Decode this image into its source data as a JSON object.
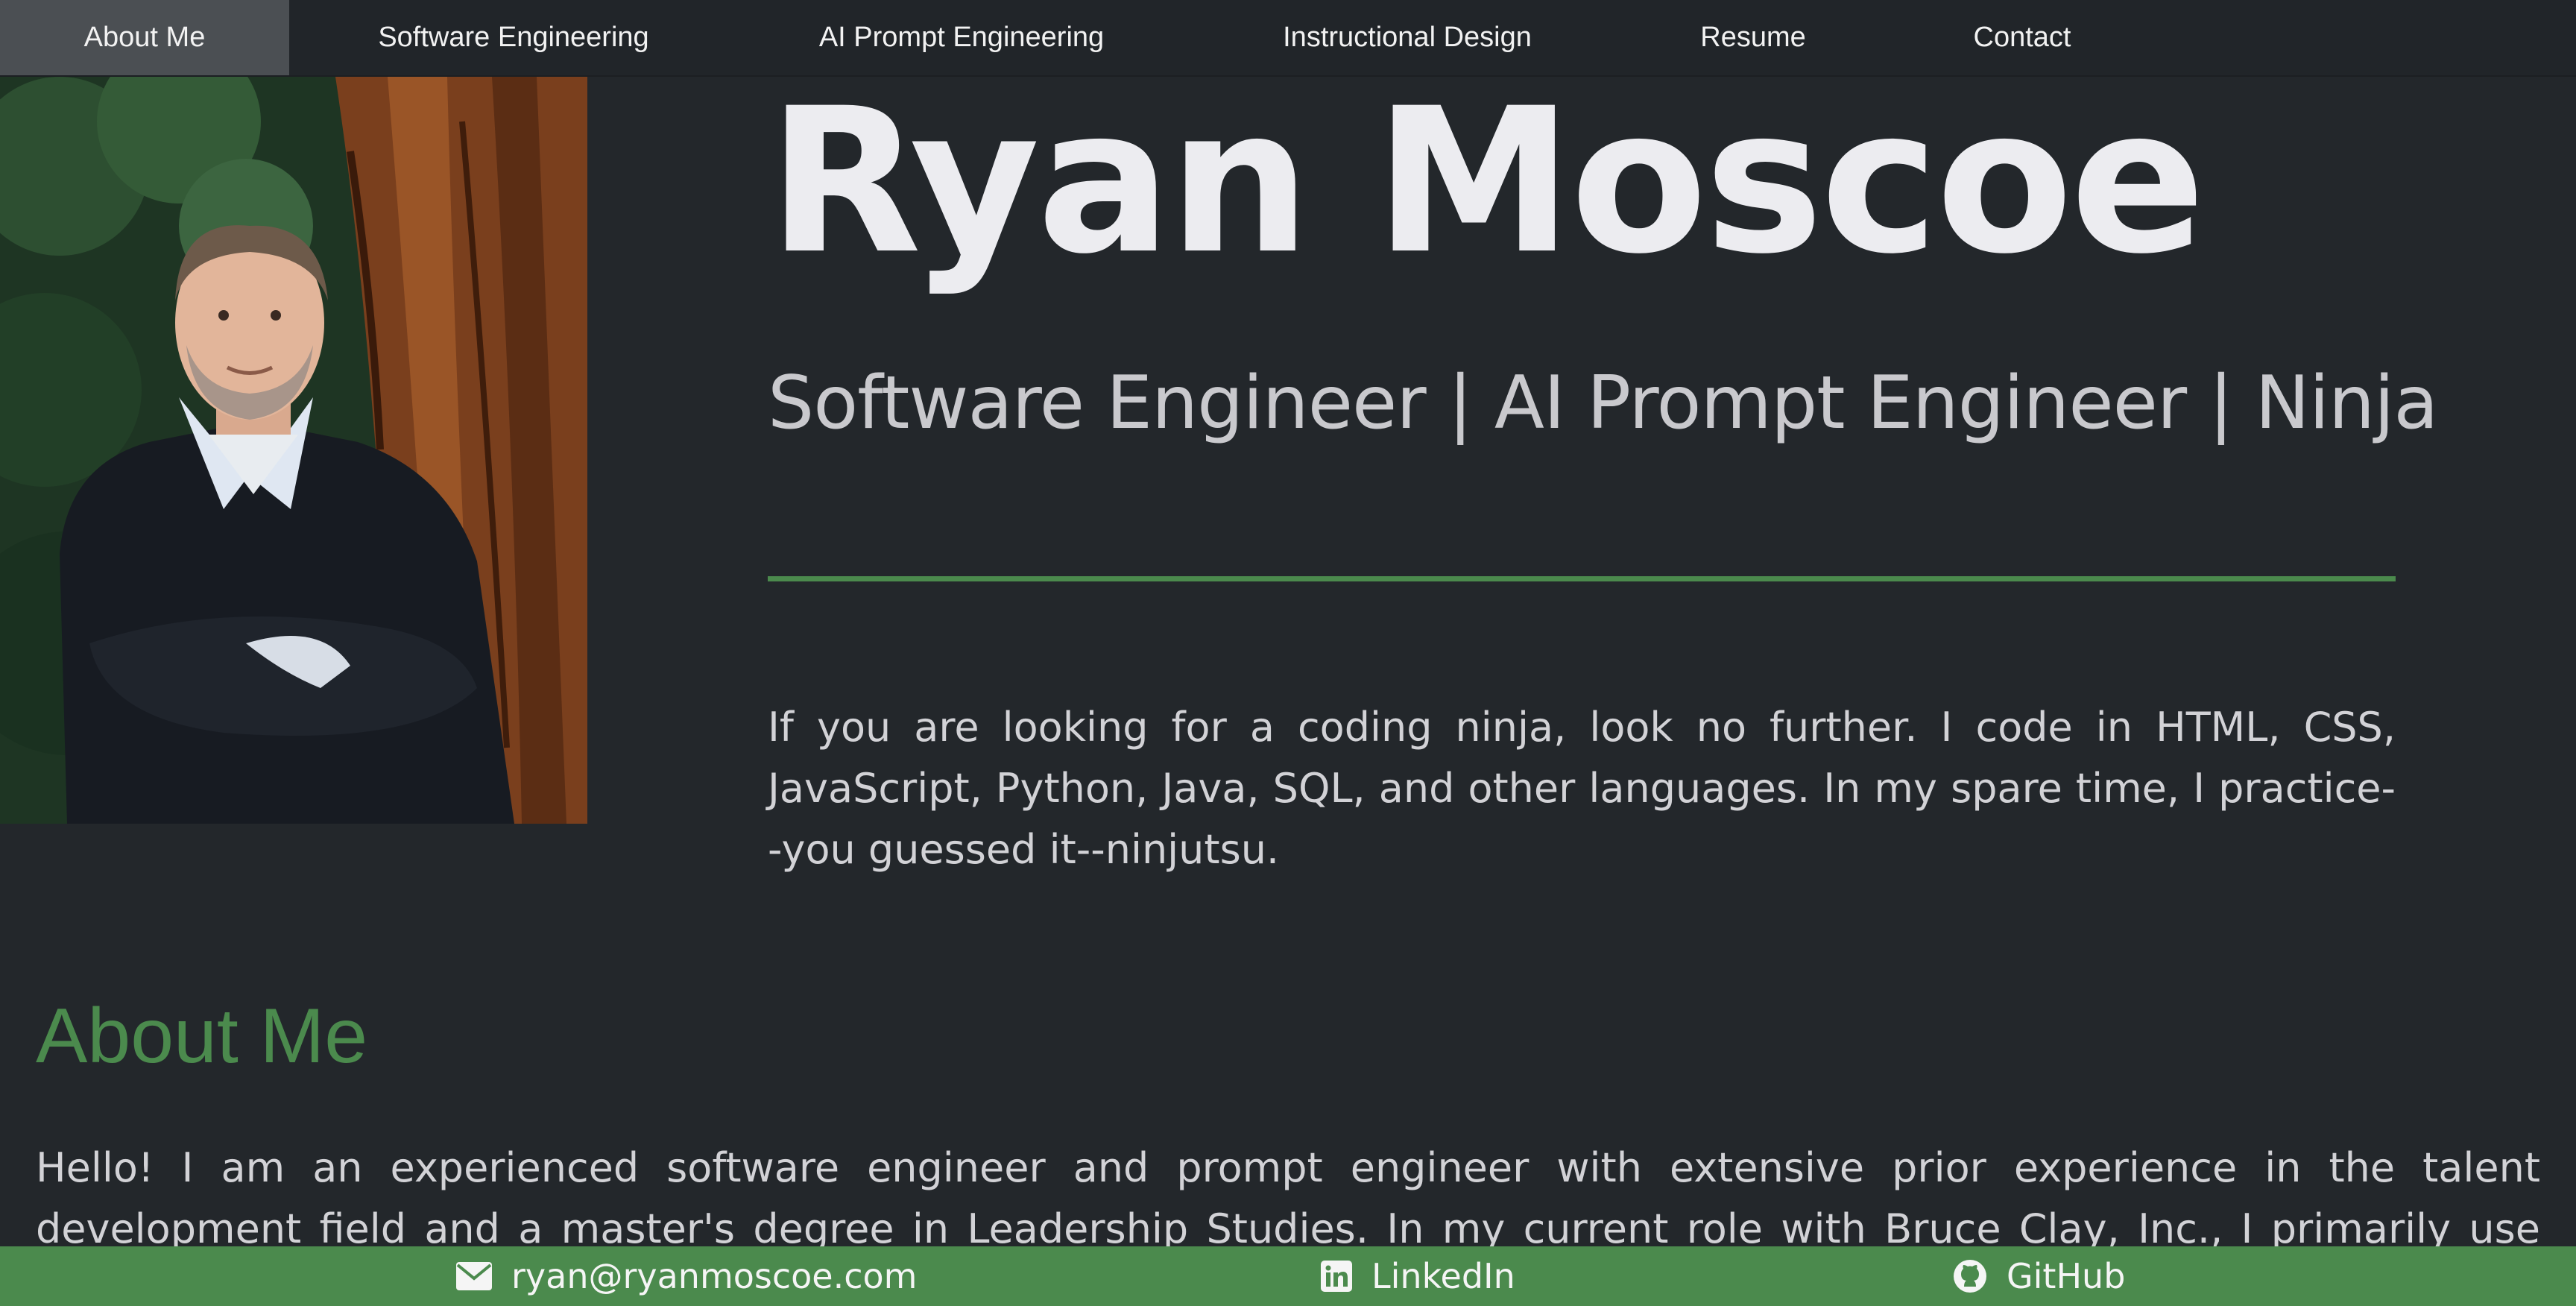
{
  "nav": {
    "items": [
      {
        "label": "About Me",
        "active": true
      },
      {
        "label": "Software Engineering",
        "active": false
      },
      {
        "label": "AI Prompt Engineering",
        "active": false
      },
      {
        "label": "Instructional Design",
        "active": false
      },
      {
        "label": "Resume",
        "active": false
      },
      {
        "label": "Contact",
        "active": false
      }
    ]
  },
  "hero": {
    "name": "Ryan Moscoe",
    "subtitle": "Software Engineer | AI Prompt Engineer | Ninja",
    "blurb": "If you are looking for a coding ninja, look no further. I code in HTML, CSS, JavaScript, Python, Java, SQL, and other languages. In my spare time, I practice--you guessed it--ninjutsu."
  },
  "about": {
    "title": "About Me",
    "text": "Hello! I am an experienced software engineer and prompt engineer with extensive prior experience in the talent development field and a master's degree in Leadership Studies. In my current role with Bruce Clay, Inc., I primarily use Python, JavaScript, and SQL, along with a variety"
  },
  "footer": {
    "email": "ryan@ryanmoscoe.com",
    "linkedin": "LinkedIn",
    "github": "GitHub"
  },
  "colors": {
    "background": "#23272b",
    "navbar": "#212529",
    "accent_green": "#4b8a4d"
  },
  "icons": {
    "email": "envelope-icon",
    "linkedin": "linkedin-icon",
    "github": "github-icon"
  }
}
